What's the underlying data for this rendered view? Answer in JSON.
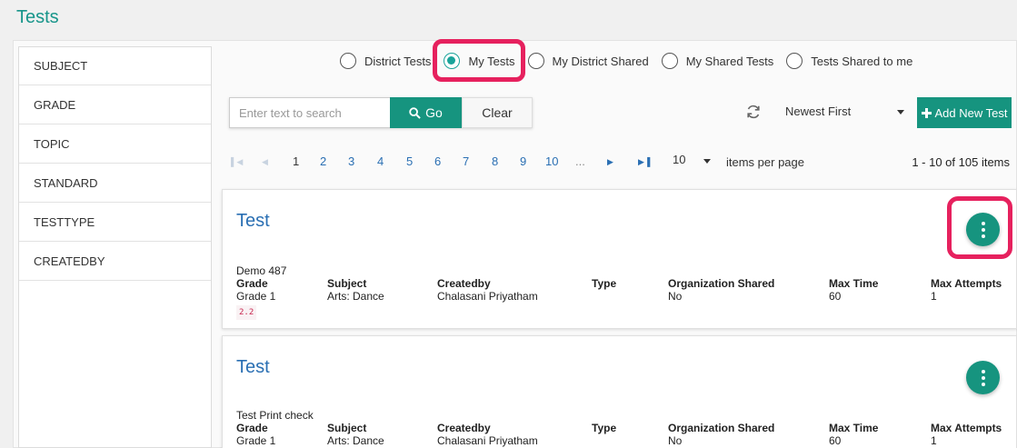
{
  "page": {
    "title": "Tests"
  },
  "sidebar": {
    "items": [
      {
        "label": "SUBJECT"
      },
      {
        "label": "GRADE"
      },
      {
        "label": "TOPIC"
      },
      {
        "label": "STANDARD"
      },
      {
        "label": "TESTTYPE"
      },
      {
        "label": "CREATEDBY"
      }
    ]
  },
  "filters": {
    "options": [
      {
        "label": "District Tests",
        "checked": false
      },
      {
        "label": "My Tests",
        "checked": true
      },
      {
        "label": "My District Shared",
        "checked": false
      },
      {
        "label": "My Shared Tests",
        "checked": false
      },
      {
        "label": "Tests Shared to me",
        "checked": false
      }
    ]
  },
  "search": {
    "placeholder": "Enter text to search",
    "value": "",
    "go_label": "Go",
    "clear_label": "Clear"
  },
  "sort": {
    "selected": "Newest First"
  },
  "add_button": {
    "label": "Add New Test"
  },
  "pagination": {
    "pages": [
      "1",
      "2",
      "3",
      "4",
      "5",
      "6",
      "7",
      "8",
      "9",
      "10"
    ],
    "ellipsis": "...",
    "current": "1",
    "per_page": "10",
    "per_page_label": "items per page",
    "range": "1 - 10 of 105 items"
  },
  "columns": {
    "grade": "Grade",
    "subject": "Subject",
    "createdby": "Createdby",
    "type": "Type",
    "org_shared": "Organization Shared",
    "max_time": "Max Time",
    "max_attempts": "Max Attempts"
  },
  "tests": [
    {
      "title": "Test",
      "name": "Demo 487",
      "grade": "Grade 1",
      "tag": "2.2",
      "subject": "Arts: Dance",
      "createdby": "Chalasani Priyatham",
      "type": "",
      "org_shared": "No",
      "max_time": "60",
      "max_attempts": "1"
    },
    {
      "title": "Test",
      "name": "Test Print check",
      "grade": "Grade 1",
      "tag": "",
      "subject": "Arts: Dance",
      "createdby": "Chalasani Priyatham",
      "type": "",
      "org_shared": "No",
      "max_time": "60",
      "max_attempts": "1"
    }
  ],
  "colors": {
    "accent": "#16947f",
    "link": "#2a6fb3",
    "highlight": "#e6215e"
  }
}
